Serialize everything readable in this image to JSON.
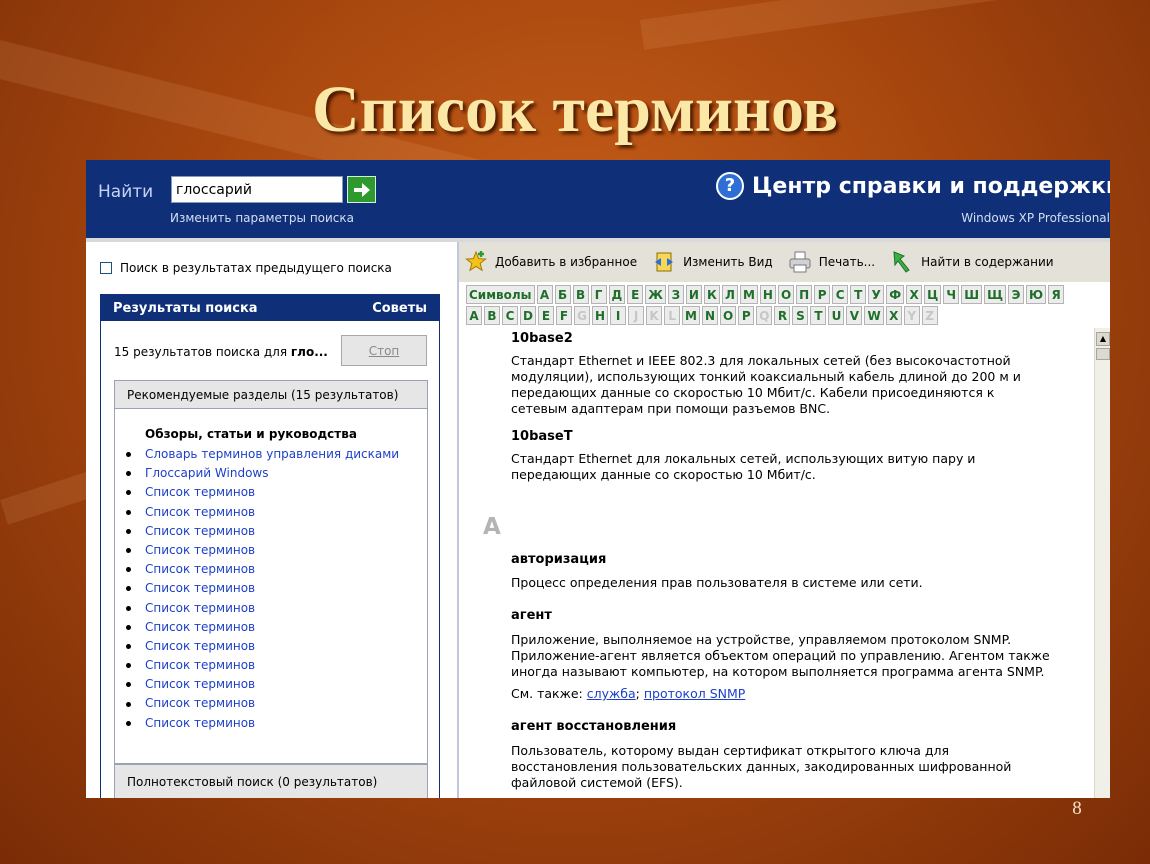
{
  "slide": {
    "title": "Список терминов",
    "page_number": "8"
  },
  "header": {
    "find_label": "Найти",
    "search_value": "глоссарий",
    "change_params": "Изменить параметры поиска",
    "help_title": "Центр справки и поддержки",
    "edition": "Windows XP Professional"
  },
  "left": {
    "prev_search_label": "Поиск в результатах предыдущего поиска",
    "results_tab": "Результаты поиска",
    "tips_tab": "Советы",
    "result_count": "15 результатов поиска для",
    "result_query": "гло...",
    "stop_label": "Стоп",
    "recommended_header": "Рекомендуемые разделы (15 результатов)",
    "group_title": "Обзоры, статьи и руководства",
    "items": [
      "Словарь терминов управления дисками",
      "Глоссарий Windows",
      "Список терминов",
      "Список терминов",
      "Список терминов",
      "Список терминов",
      "Список терминов",
      "Список терминов",
      "Список терминов",
      "Список терминов",
      "Список терминов",
      "Список терминов",
      "Список терминов",
      "Список терминов",
      "Список терминов"
    ],
    "fulltext_header": "Полнотекстовый поиск (0 результатов)"
  },
  "toolbar": {
    "add_favorites": "Добавить в избранное",
    "change_view": "Изменить Вид",
    "print": "Печать...",
    "find_in_contents": "Найти в содержании"
  },
  "alphabet": {
    "symbols_label": "Символы",
    "cyrillic": [
      "А",
      "Б",
      "В",
      "Г",
      "Д",
      "Е",
      "Ж",
      "З",
      "И",
      "К",
      "Л",
      "М",
      "Н",
      "О",
      "П",
      "Р",
      "С",
      "Т",
      "У",
      "Ф",
      "Х",
      "Ц",
      "Ч",
      "Ш",
      "Щ",
      "Э",
      "Ю",
      "Я"
    ],
    "latin": [
      "A",
      "B",
      "C",
      "D",
      "E",
      "F",
      "G",
      "H",
      "I",
      "J",
      "K",
      "L",
      "M",
      "N",
      "O",
      "P",
      "Q",
      "R",
      "S",
      "T",
      "U",
      "V",
      "W",
      "X",
      "Y",
      "Z"
    ],
    "latin_disabled": [
      "G",
      "J",
      "K",
      "L",
      "Q",
      "Y",
      "Z"
    ]
  },
  "content": {
    "t1_term": "10base2",
    "t1_def": [
      "Стандарт Ethernet и IEEE 802.3 для локальных сетей (без высокочастотной",
      "модуляции), использующих тонкий коаксиальный кабель длиной до 200 м и",
      "передающих данные со скоростью 10 Мбит/с. Кабели присоединяются к",
      "сетевым адаптерам при помощи разъемов BNC."
    ],
    "t2_term": "10baseT",
    "t2_def": [
      "Стандарт Ethernet для локальных сетей, использующих витую пару и",
      "передающих данные со скоростью 10 Мбит/с."
    ],
    "section_letter": "A",
    "t3_term": "авторизация",
    "t3_def": "Процесс определения прав пользователя в системе или сети.",
    "t4_term": "агент",
    "t4_def": [
      "Приложение, выполняемое на устройстве, управляемом протоколом SNMP.",
      "Приложение-агент является объектом операций по управлению. Агентом также",
      "иногда называют компьютер, на котором выполняется программа агента SNMP."
    ],
    "see_also_label": "См. также:",
    "see_also_1": "служба",
    "see_also_sep": ";",
    "see_also_2": "протокол SNMP",
    "t5_term": "агент восстановления",
    "t5_def": [
      "Пользователь, которому выдан сертификат открытого ключа для",
      "восстановления пользовательских данных, закодированных шифрованной",
      "файловой системой (EFS)."
    ]
  },
  "colors": {
    "header_blue": "#0f2f79",
    "letter_green": "#1f6f2a",
    "link_blue": "#1c3fc9",
    "title_cream": "#fbe8a6"
  }
}
